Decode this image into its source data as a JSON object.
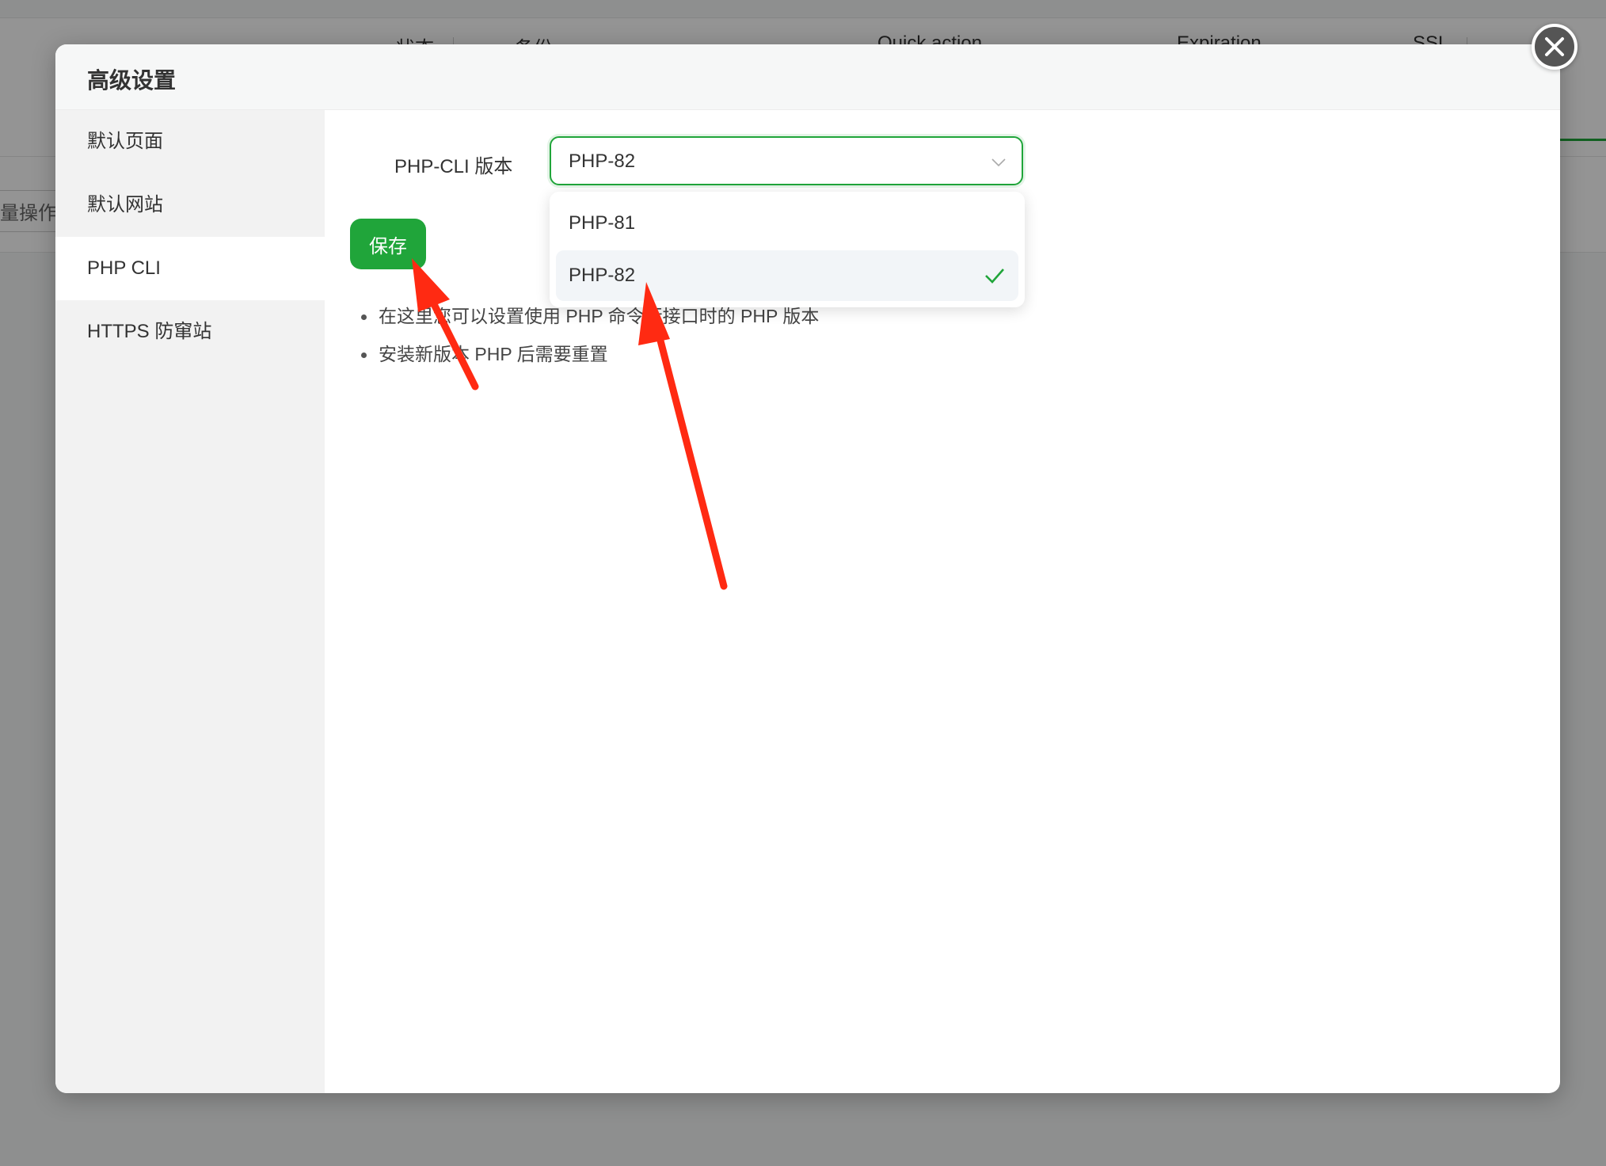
{
  "background": {
    "columns": [
      "状态",
      "备份",
      "Quick action",
      "Expiration",
      "SSL"
    ],
    "batch_label": "量操作"
  },
  "dialog": {
    "title": "高级设置",
    "sidebar": [
      {
        "label": "默认页面",
        "active": false
      },
      {
        "label": "默认网站",
        "active": false
      },
      {
        "label": "PHP CLI",
        "active": true
      },
      {
        "label": "HTTPS 防窜站",
        "active": false
      }
    ],
    "form": {
      "label": "PHP-CLI 版本",
      "selected": "PHP-82",
      "options": [
        {
          "label": "PHP-81",
          "selected": false
        },
        {
          "label": "PHP-82",
          "selected": true
        }
      ],
      "save_label": "保存"
    },
    "tips": [
      "在这里您可以设置使用 PHP 命令行接口时的 PHP 版本",
      "安装新版本 PHP 后需要重置"
    ]
  },
  "colors": {
    "accent": "#20a53a",
    "annotation": "#ff2a12"
  }
}
